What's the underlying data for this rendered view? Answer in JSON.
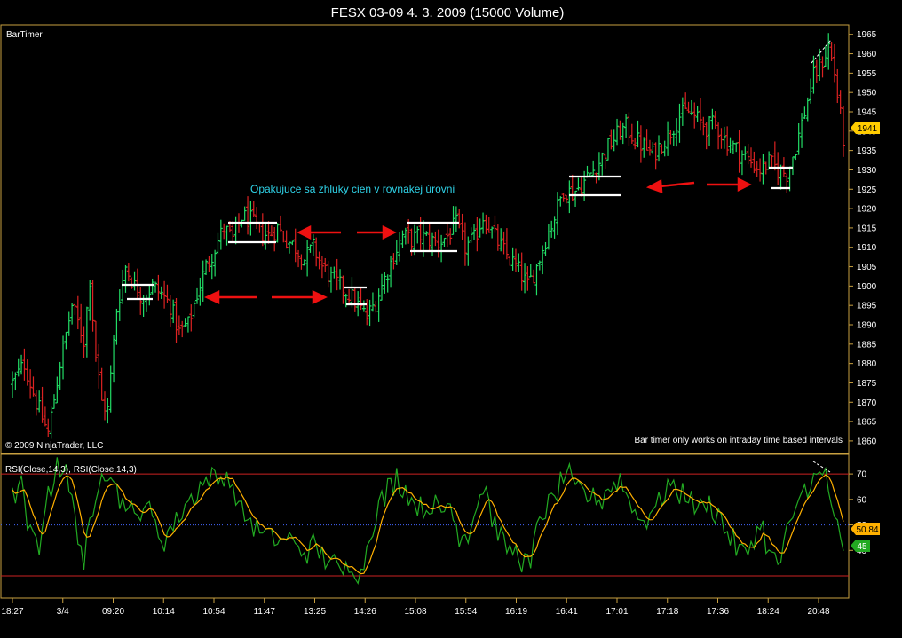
{
  "window": {
    "title": "FESX 03-09  4. 3. 2009 (15000 Volume)"
  },
  "labels": {
    "indicator": "BarTimer",
    "copyright": "© 2009 NinjaTrader, LLC",
    "bar_timer_note": "Bar timer only works on intraday time based intervals",
    "rsi_legend": "RSI(Close,14,3), RSI(Close,14,3)",
    "annotation": "Opakujuce sa zhluky cien  v rovnakej úrovni"
  },
  "colors": {
    "background": "#000000",
    "up_bar": "#22dd66",
    "down_bar": "#dd2222",
    "price_tag": "#ffcc00",
    "rsi_line": "#ffb000",
    "rsi_avg": "#22aa22",
    "level_line": "#cc2222",
    "mid_line": "#4466ff",
    "arrow": "#ee1111",
    "cluster_box": "#ffffff",
    "frame": "#c8a040"
  },
  "chart_data": [
    {
      "type": "bar",
      "subtype": "ohlc",
      "title": "FESX 03-09  4. 3. 2009 (15000 Volume)",
      "ylim": [
        1857,
        1967
      ],
      "yticks": [
        1860,
        1865,
        1870,
        1875,
        1880,
        1885,
        1890,
        1895,
        1900,
        1905,
        1910,
        1915,
        1920,
        1925,
        1930,
        1935,
        1940,
        1945,
        1950,
        1955,
        1960,
        1965
      ],
      "last_price": "1941",
      "x_labels": [
        "18:27",
        "3/4",
        "09:20",
        "10:14",
        "10:54",
        "11:47",
        "13:25",
        "14:26",
        "15:08",
        "15:54",
        "16:19",
        "16:41",
        "17:01",
        "17:18",
        "17:36",
        "18:24",
        "20:48"
      ],
      "anchors": [
        [
          0,
          1875
        ],
        [
          4,
          1880
        ],
        [
          8,
          1870
        ],
        [
          12,
          1862
        ],
        [
          16,
          1880
        ],
        [
          20,
          1895
        ],
        [
          24,
          1886
        ],
        [
          26,
          1902
        ],
        [
          28,
          1882
        ],
        [
          30,
          1870
        ],
        [
          32,
          1868
        ],
        [
          35,
          1894
        ],
        [
          38,
          1905
        ],
        [
          41,
          1900
        ],
        [
          44,
          1897
        ],
        [
          47,
          1900
        ],
        [
          50,
          1898
        ],
        [
          53,
          1895
        ],
        [
          56,
          1888
        ],
        [
          59,
          1890
        ],
        [
          62,
          1898
        ],
        [
          65,
          1905
        ],
        [
          68,
          1910
        ],
        [
          71,
          1915
        ],
        [
          74,
          1912
        ],
        [
          77,
          1918
        ],
        [
          80,
          1917
        ],
        [
          83,
          1914
        ],
        [
          86,
          1913
        ],
        [
          89,
          1915
        ],
        [
          92,
          1912
        ],
        [
          95,
          1910
        ],
        [
          98,
          1907
        ],
        [
          101,
          1910
        ],
        [
          104,
          1905
        ],
        [
          107,
          1902
        ],
        [
          110,
          1900
        ],
        [
          113,
          1898
        ],
        [
          116,
          1895
        ],
        [
          119,
          1892
        ],
        [
          122,
          1896
        ],
        [
          125,
          1902
        ],
        [
          128,
          1908
        ],
        [
          131,
          1913
        ],
        [
          134,
          1912
        ],
        [
          137,
          1913
        ],
        [
          140,
          1912
        ],
        [
          143,
          1911
        ],
        [
          146,
          1913
        ],
        [
          149,
          1916
        ],
        [
          152,
          1910
        ],
        [
          155,
          1912
        ],
        [
          158,
          1918
        ],
        [
          161,
          1914
        ],
        [
          164,
          1910
        ],
        [
          167,
          1907
        ],
        [
          170,
          1904
        ],
        [
          173,
          1900
        ],
        [
          176,
          1905
        ],
        [
          179,
          1912
        ],
        [
          182,
          1918
        ],
        [
          185,
          1925
        ],
        [
          188,
          1924
        ],
        [
          191,
          1926
        ],
        [
          194,
          1929
        ],
        [
          197,
          1932
        ],
        [
          200,
          1936
        ],
        [
          203,
          1939
        ],
        [
          206,
          1941
        ],
        [
          209,
          1938
        ],
        [
          212,
          1936
        ],
        [
          215,
          1934
        ],
        [
          218,
          1937
        ],
        [
          221,
          1940
        ],
        [
          224,
          1944
        ],
        [
          227,
          1945
        ],
        [
          230,
          1943
        ],
        [
          233,
          1941
        ],
        [
          236,
          1942
        ],
        [
          239,
          1938
        ],
        [
          242,
          1936
        ],
        [
          245,
          1934
        ],
        [
          248,
          1932
        ],
        [
          251,
          1930
        ],
        [
          254,
          1932
        ],
        [
          257,
          1930
        ],
        [
          260,
          1929
        ],
        [
          263,
          1936
        ],
        [
          266,
          1945
        ],
        [
          269,
          1954
        ],
        [
          272,
          1958
        ],
        [
          274,
          1962
        ],
        [
          276,
          1955
        ],
        [
          279,
          1938
        ]
      ]
    },
    {
      "type": "line",
      "title": "RSI(Close,14,3), RSI(Close,14,3)",
      "ylim": [
        22,
        77
      ],
      "yticks": [
        40,
        50,
        60,
        70
      ],
      "levels": [
        70,
        30
      ],
      "midline": 50,
      "last_values": [
        "50.84",
        "45"
      ],
      "anchors": [
        [
          0,
          62
        ],
        [
          3,
          64
        ],
        [
          6,
          53
        ],
        [
          9,
          45
        ],
        [
          12,
          55
        ],
        [
          15,
          68
        ],
        [
          18,
          70
        ],
        [
          21,
          60
        ],
        [
          24,
          42
        ],
        [
          27,
          50
        ],
        [
          30,
          66
        ],
        [
          33,
          68
        ],
        [
          36,
          63
        ],
        [
          39,
          58
        ],
        [
          42,
          55
        ],
        [
          45,
          57
        ],
        [
          48,
          52
        ],
        [
          51,
          45
        ],
        [
          54,
          48
        ],
        [
          57,
          53
        ],
        [
          60,
          58
        ],
        [
          63,
          62
        ],
        [
          66,
          66
        ],
        [
          69,
          68
        ],
        [
          72,
          70
        ],
        [
          75,
          64
        ],
        [
          78,
          57
        ],
        [
          81,
          52
        ],
        [
          84,
          48
        ],
        [
          87,
          47
        ],
        [
          90,
          44
        ],
        [
          93,
          45
        ],
        [
          96,
          43
        ],
        [
          99,
          40
        ],
        [
          102,
          42
        ],
        [
          105,
          38
        ],
        [
          108,
          36
        ],
        [
          111,
          33
        ],
        [
          114,
          35
        ],
        [
          117,
          30
        ],
        [
          120,
          40
        ],
        [
          123,
          52
        ],
        [
          126,
          60
        ],
        [
          129,
          66
        ],
        [
          132,
          64
        ],
        [
          135,
          60
        ],
        [
          138,
          58
        ],
        [
          141,
          57
        ],
        [
          144,
          56
        ],
        [
          147,
          58
        ],
        [
          150,
          50
        ],
        [
          153,
          46
        ],
        [
          156,
          54
        ],
        [
          159,
          62
        ],
        [
          162,
          54
        ],
        [
          165,
          46
        ],
        [
          168,
          42
        ],
        [
          171,
          38
        ],
        [
          174,
          36
        ],
        [
          177,
          48
        ],
        [
          180,
          55
        ],
        [
          183,
          60
        ],
        [
          186,
          68
        ],
        [
          189,
          66
        ],
        [
          192,
          64
        ],
        [
          195,
          62
        ],
        [
          198,
          60
        ],
        [
          201,
          63
        ],
        [
          204,
          66
        ],
        [
          207,
          62
        ],
        [
          210,
          56
        ],
        [
          213,
          52
        ],
        [
          216,
          55
        ],
        [
          219,
          61
        ],
        [
          222,
          64
        ],
        [
          225,
          63
        ],
        [
          228,
          60
        ],
        [
          231,
          58
        ],
        [
          234,
          59
        ],
        [
          237,
          55
        ],
        [
          240,
          50
        ],
        [
          243,
          44
        ],
        [
          246,
          40
        ],
        [
          249,
          43
        ],
        [
          252,
          48
        ],
        [
          255,
          40
        ],
        [
          258,
          38
        ],
        [
          261,
          46
        ],
        [
          264,
          56
        ],
        [
          267,
          63
        ],
        [
          270,
          67
        ],
        [
          273,
          70
        ],
        [
          276,
          60
        ],
        [
          279,
          45
        ]
      ]
    }
  ]
}
